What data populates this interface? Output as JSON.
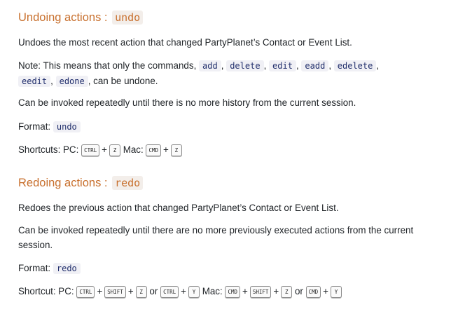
{
  "undo": {
    "title": "Undoing actions :",
    "command": "undo",
    "description": "Undoes the most recent action that changed PartyPlanet’s Contact or Event List.",
    "note_prefix": "Note: This means that only the commands,",
    "note_commands": [
      "add",
      "delete",
      "edit",
      "eadd",
      "edelete",
      "eedit",
      "edone"
    ],
    "note_suffix": ", can be undone.",
    "repeat": "Can be invoked repeatedly until there is no more history from the current session.",
    "format_label": "Format:",
    "format_value": "undo",
    "shortcut_label": "Shortcuts: PC:",
    "pc_keys": [
      "CTRL",
      "Z"
    ],
    "mac_label": "Mac:",
    "mac_keys": [
      "CMD",
      "Z"
    ]
  },
  "redo": {
    "title": "Redoing actions :",
    "command": "redo",
    "description": "Redoes the previous action that changed PartyPlanet’s Contact or Event List.",
    "repeat": "Can be invoked repeatedly until there are no more previously executed actions from the current session.",
    "format_label": "Format:",
    "format_value": "redo",
    "shortcut_label": "Shortcut: PC:",
    "pc_keys_a": [
      "CTRL",
      "SHIFT",
      "Z"
    ],
    "or": "or",
    "pc_keys_b": [
      "CTRL",
      "Y"
    ],
    "mac_label": "Mac:",
    "mac_keys_a": [
      "CMD",
      "SHIFT",
      "Z"
    ],
    "mac_keys_b": [
      "CMD",
      "Y"
    ]
  },
  "plus": "+",
  "comma": ","
}
